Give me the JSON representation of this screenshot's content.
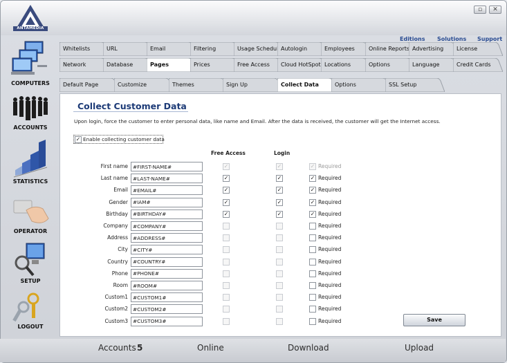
{
  "brand": {
    "logo_text": "ANTAMEDIA"
  },
  "window": {
    "restore": "▫",
    "close": "✕"
  },
  "top_links": [
    "Editions",
    "Solutions",
    "Support"
  ],
  "nav": [
    {
      "label": "COMPUTERS",
      "icon": "computers-icon"
    },
    {
      "label": "ACCOUNTS",
      "icon": "accounts-icon"
    },
    {
      "label": "STATISTICS",
      "icon": "statistics-icon"
    },
    {
      "label": "OPERATOR",
      "icon": "operator-icon"
    },
    {
      "label": "SETUP",
      "icon": "setup-icon"
    },
    {
      "label": "LOGOUT",
      "icon": "logout-icon"
    }
  ],
  "tabs_row1": [
    "Whitelists",
    "URL",
    "Email",
    "Filtering",
    "Usage Schedule",
    "Autologin",
    "Employees",
    "Online Reports",
    "Advertising",
    "License"
  ],
  "tabs_row2": [
    "Network",
    "Database",
    "Pages",
    "Prices",
    "Free Access",
    "Cloud HotSpot",
    "Locations",
    "Options",
    "Language",
    "Credit Cards"
  ],
  "tabs_row2_selected": "Pages",
  "tabs_row3": [
    "Default Page",
    "Customize",
    "Themes",
    "Sign Up",
    "Collect Data",
    "Options",
    "SSL Setup"
  ],
  "tabs_row3_selected": "Collect Data",
  "section": {
    "title": "Collect Customer Data",
    "description": "Upon login, force the customer to enter personal data, like name and Email. After the data is received, the customer will get the Internet access.",
    "enable_label": "Enable collecting customer data",
    "enable_checked": true,
    "col_free_access": "Free Access",
    "col_login": "Login",
    "required_label": "Required"
  },
  "fields": [
    {
      "label": "First name",
      "value": "#FIRST-NAME#",
      "free": true,
      "login": true,
      "required": true,
      "disabled": true
    },
    {
      "label": "Last name",
      "value": "#LAST-NAME#",
      "free": true,
      "login": true,
      "required": true,
      "disabled": false
    },
    {
      "label": "Email",
      "value": "#EMAIL#",
      "free": true,
      "login": true,
      "required": true,
      "disabled": false
    },
    {
      "label": "Gender",
      "value": "#IAM#",
      "free": true,
      "login": true,
      "required": true,
      "disabled": false
    },
    {
      "label": "Birthday",
      "value": "#BIRTHDAY#",
      "free": true,
      "login": true,
      "required": true,
      "disabled": false
    },
    {
      "label": "Company",
      "value": "#COMPANY#",
      "free": false,
      "login": false,
      "required": false,
      "disabled": false
    },
    {
      "label": "Address",
      "value": "#ADDRESS#",
      "free": false,
      "login": false,
      "required": false,
      "disabled": false
    },
    {
      "label": "City",
      "value": "#CITY#",
      "free": false,
      "login": false,
      "required": false,
      "disabled": false
    },
    {
      "label": "Country",
      "value": "#COUNTRY#",
      "free": false,
      "login": false,
      "required": false,
      "disabled": false
    },
    {
      "label": "Phone",
      "value": "#PHONE#",
      "free": false,
      "login": false,
      "required": false,
      "disabled": false
    },
    {
      "label": "Room",
      "value": "#ROOM#",
      "free": false,
      "login": false,
      "required": false,
      "disabled": false
    },
    {
      "label": "Custom1",
      "value": "#CUSTOM1#",
      "free": false,
      "login": false,
      "required": false,
      "disabled": false
    },
    {
      "label": "Custom2",
      "value": "#CUSTOM2#",
      "free": false,
      "login": false,
      "required": false,
      "disabled": false
    },
    {
      "label": "Custom3",
      "value": "#CUSTOM3#",
      "free": false,
      "login": false,
      "required": false,
      "disabled": false
    }
  ],
  "save_label": "Save",
  "status": {
    "accounts_label": "Accounts",
    "accounts_value": "5",
    "online_label": "Online",
    "download_label": "Download",
    "upload_label": "Upload"
  },
  "colors": {
    "accent": "#1d3b77",
    "link": "#2a4c92",
    "tab": "#d9dce1",
    "tab_selected": "#ffffff"
  }
}
